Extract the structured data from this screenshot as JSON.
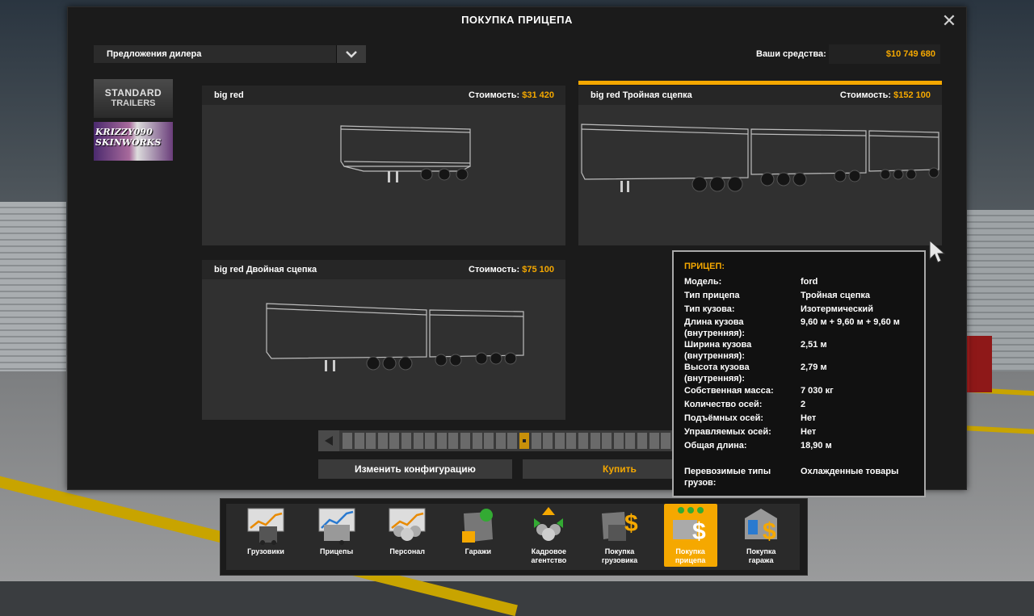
{
  "window": {
    "title": "ПОКУПКА ПРИЦЕПА"
  },
  "dealer": {
    "selected": "Предложения дилера"
  },
  "funds": {
    "label": "Ваши средства:",
    "value": "$10 749 680"
  },
  "brands": [
    {
      "line1": "STANDARD",
      "line2": "TRAILERS"
    },
    {
      "line1": "KRIZZY090",
      "line2": "SKINWORKS"
    }
  ],
  "offers": [
    {
      "name": "big red",
      "cost_label": "Стоимость:",
      "cost": "$31 420"
    },
    {
      "name": "big red Тройная сцепка",
      "cost_label": "Стоимость:",
      "cost": "$152 100"
    },
    {
      "name": "big red Двойная сцепка",
      "cost_label": "Стоимость:",
      "cost": "$75 100"
    }
  ],
  "slider": {
    "segments": 30,
    "selected": 15
  },
  "buttons": {
    "config": "Изменить конфигурацию",
    "buy": "Купить"
  },
  "tooltip": {
    "title": "ПРИЦЕП:",
    "rows": [
      {
        "k": "Модель:",
        "v": "ford"
      },
      {
        "k": "Тип прицепа",
        "v": "Тройная сцепка"
      },
      {
        "k": "Тип кузова:",
        "v": "Изотермический"
      },
      {
        "k": "Длина кузова (внутренняя):",
        "v": "9,60 м + 9,60 м + 9,60 м"
      },
      {
        "k": "Ширина кузова (внутренняя):",
        "v": "2,51 м"
      },
      {
        "k": "Высота кузова (внутренняя):",
        "v": "2,79 м"
      },
      {
        "k": "Собственная масса:",
        "v": "7 030 кг"
      },
      {
        "k": "Количество осей:",
        "v": "2"
      },
      {
        "k": "Подъёмных осей:",
        "v": "Нет"
      },
      {
        "k": "Управляемых осей:",
        "v": "Нет"
      },
      {
        "k": "Общая длина:",
        "v": "18,90 м"
      },
      {
        "k": "Перевозимые типы грузов:",
        "v": "Охлажденные товары"
      }
    ]
  },
  "dock": [
    {
      "l1": "Грузовики",
      "l2": "",
      "icon": "trucks-chart-icon"
    },
    {
      "l1": "Прицепы",
      "l2": "",
      "icon": "trailers-chart-icon"
    },
    {
      "l1": "Персонал",
      "l2": "",
      "icon": "staff-chart-icon"
    },
    {
      "l1": "Гаражи",
      "l2": "",
      "icon": "garage-map-icon"
    },
    {
      "l1": "Кадровое",
      "l2": "агентство",
      "icon": "recruitment-agency-icon"
    },
    {
      "l1": "Покупка",
      "l2": "грузовика",
      "icon": "buy-truck-icon"
    },
    {
      "l1": "Покупка",
      "l2": "прицепа",
      "icon": "buy-trailer-icon",
      "active": true
    },
    {
      "l1": "Покупка",
      "l2": "гаража",
      "icon": "buy-garage-icon"
    }
  ]
}
